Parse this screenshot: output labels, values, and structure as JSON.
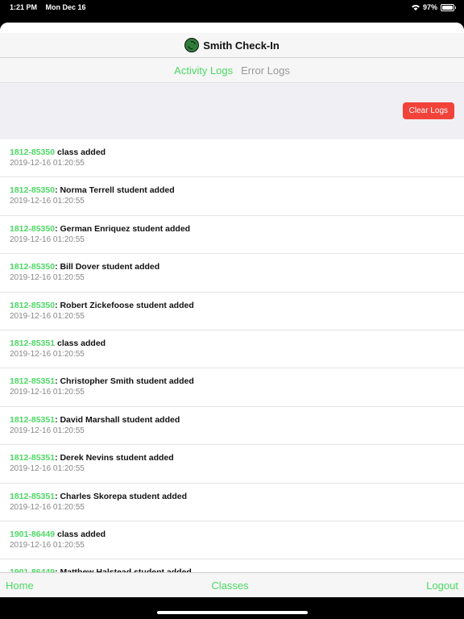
{
  "status_bar": {
    "time": "1:21 PM",
    "date": "Mon Dec 16",
    "battery_text": "97%",
    "battery_level": 0.97,
    "wifi_icon": "wifi-icon",
    "battery_icon": "battery-icon"
  },
  "header": {
    "logo_icon": "smith-logo-icon",
    "title": "Smith Check-In"
  },
  "tabs": [
    {
      "label": "Activity Logs",
      "active": true
    },
    {
      "label": "Error Logs",
      "active": false
    }
  ],
  "toolbar": {
    "clear_label": "Clear Logs",
    "accent": "#f2433a"
  },
  "logs": [
    {
      "code": "1812-85350",
      "message": " class added",
      "timestamp": "2019-12-16 01:20:55"
    },
    {
      "code": "1812-85350",
      "message": ": Norma Terrell student added",
      "timestamp": "2019-12-16 01:20:55"
    },
    {
      "code": "1812-85350",
      "message": ": German Enriquez student added",
      "timestamp": "2019-12-16 01:20:55"
    },
    {
      "code": "1812-85350",
      "message": ": Bill Dover student added",
      "timestamp": "2019-12-16 01:20:55"
    },
    {
      "code": "1812-85350",
      "message": ": Robert Zickefoose student added",
      "timestamp": "2019-12-16 01:20:55"
    },
    {
      "code": "1812-85351",
      "message": " class added",
      "timestamp": "2019-12-16 01:20:55"
    },
    {
      "code": "1812-85351",
      "message": ": Christopher Smith student added",
      "timestamp": "2019-12-16 01:20:55"
    },
    {
      "code": "1812-85351",
      "message": ": David Marshall student added",
      "timestamp": "2019-12-16 01:20:55"
    },
    {
      "code": "1812-85351",
      "message": ": Derek Nevins student added",
      "timestamp": "2019-12-16 01:20:55"
    },
    {
      "code": "1812-85351",
      "message": ": Charles Skorepa student added",
      "timestamp": "2019-12-16 01:20:55"
    },
    {
      "code": "1901-86449",
      "message": " class added",
      "timestamp": "2019-12-16 01:20:55"
    },
    {
      "code": "1901-86449",
      "message": ": Matthew Halstead student added",
      "timestamp": ""
    }
  ],
  "bottom_nav": {
    "home": "Home",
    "classes": "Classes",
    "logout": "Logout"
  },
  "colors": {
    "accent_green": "#4cd964",
    "clear_red": "#f2433a"
  }
}
